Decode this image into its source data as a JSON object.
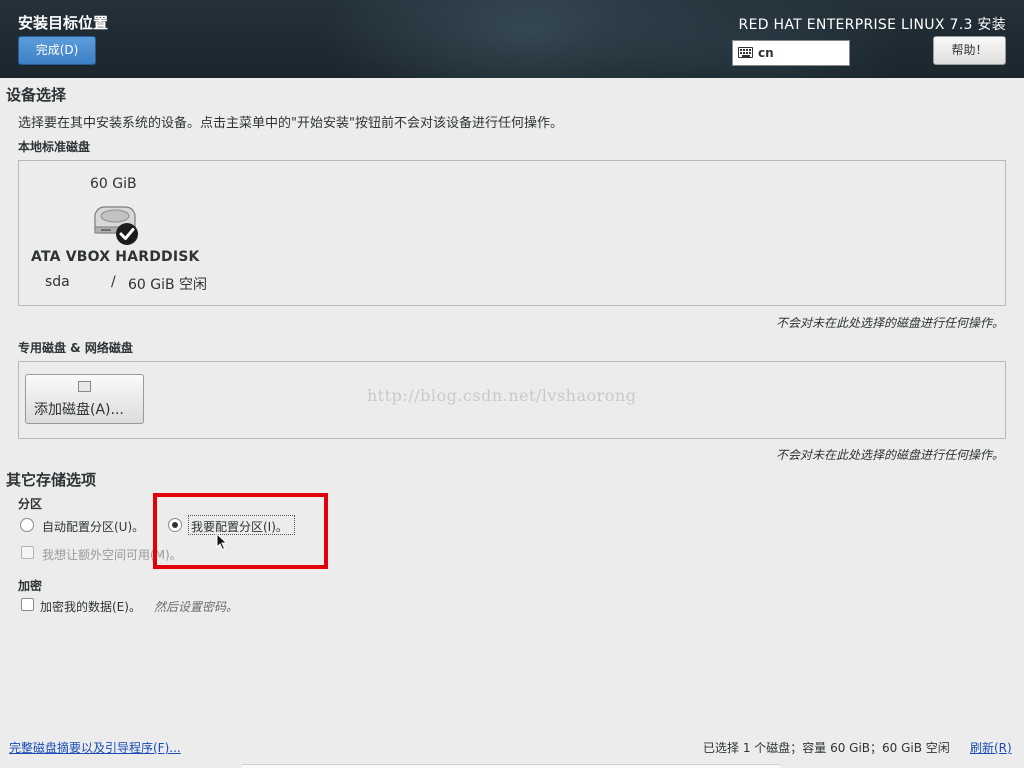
{
  "header": {
    "title": "安装目标位置",
    "done_label": "完成(D)",
    "product": "RED HAT ENTERPRISE LINUX 7.3 安装",
    "keyboard_layout": "cn",
    "help_label": "帮助！"
  },
  "device_selection": {
    "heading": "设备选择",
    "description": "选择要在其中安装系统的设备。点击主菜单中的\"开始安装\"按钮前不会对该设备进行任何操作。",
    "local_heading": "本地标准磁盘",
    "disk": {
      "size": "60 GiB",
      "name": "ATA VBOX HARDDISK",
      "device": "sda",
      "separator": "/",
      "free": "60 GiB 空闲",
      "selected": true
    },
    "local_note": "不会对未在此处选择的磁盘进行任何操作。",
    "specialized_heading": "专用磁盘 & 网络磁盘",
    "add_disk_label": "添加磁盘(A)...",
    "specialized_note": "不会对未在此处选择的磁盘进行任何操作。",
    "watermark": "http://blog.csdn.net/lvshaorong"
  },
  "other_options": {
    "heading": "其它存储选项",
    "partition_heading": "分区",
    "auto_partition_label": "自动配置分区(U)。",
    "manual_partition_label": "我要配置分区(I)。",
    "selected_partition_mode": "manual",
    "extra_space_label": "我想让额外空间可用(M)。",
    "encryption_heading": "加密",
    "encrypt_label": "加密我的数据(E)。",
    "encrypt_hint": "然后设置密码。"
  },
  "footer": {
    "summary_link": "完整磁盘摘要以及引导程序(F)...",
    "status": "已选择 1 个磁盘；容量 60 GiB；60 GiB 空闲",
    "refresh_link": "刷新(R)"
  },
  "colors": {
    "header_bg": "#1b262d",
    "accent_blue": "#3d7fc4",
    "highlight_red": "#e2000b",
    "link_blue": "#1a4cb5"
  }
}
